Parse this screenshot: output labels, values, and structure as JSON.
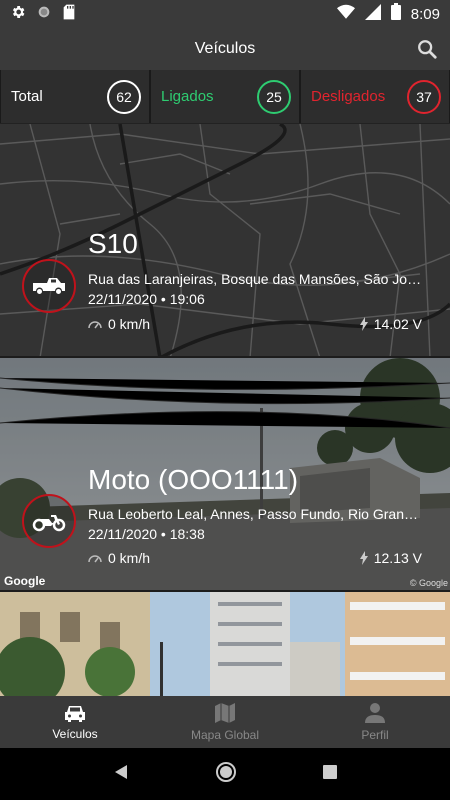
{
  "status_bar": {
    "time": "8:09"
  },
  "header": {
    "title": "Veículos"
  },
  "summary": [
    {
      "label": "Total",
      "count": "62",
      "color": "#ffffff"
    },
    {
      "label": "Ligados",
      "count": "25",
      "color": "#2ecc71"
    },
    {
      "label": "Desligados",
      "count": "37",
      "color": "#e0242e"
    }
  ],
  "vehicles": [
    {
      "name": "S10",
      "address": "Rua das Laranjeiras, Bosque das Mansões, São José - SC",
      "datetime": "22/11/2020 • 19:06",
      "speed": "0 km/h",
      "voltage": "14.02 V",
      "icon": "pickup-truck-icon"
    },
    {
      "name": "Moto (OOO1111)",
      "address": "Rua Leoberto Leal, Annes, Passo Fundo, Rio Grande do Sul",
      "datetime": "22/11/2020 • 18:38",
      "speed": "0 km/h",
      "voltage": "12.13 V",
      "icon": "motorcycle-icon",
      "watermark": "Google",
      "watermark_small": "© Google"
    }
  ],
  "bottom_nav": [
    {
      "label": "Veículos",
      "icon": "car-icon",
      "active": true
    },
    {
      "label": "Mapa Global",
      "icon": "map-icon",
      "active": false
    },
    {
      "label": "Perfil",
      "icon": "person-icon",
      "active": false
    }
  ],
  "colors": {
    "accent_red": "#c0121b",
    "green": "#2ecc71",
    "bar": "#3a3a3a"
  }
}
